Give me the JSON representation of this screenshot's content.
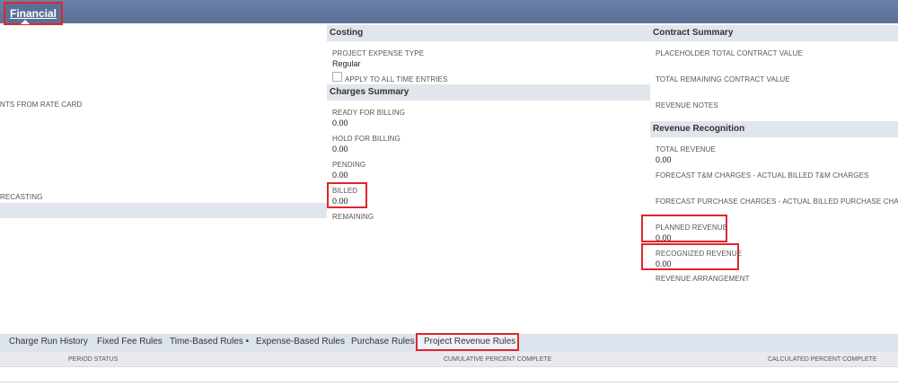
{
  "tabs": {
    "financial": "Financial"
  },
  "left": {
    "rate_card_label": "NTS FROM RATE CARD",
    "forecasting_label": "RECASTING"
  },
  "costing": {
    "header": "Costing",
    "expense_type_label": "PROJECT EXPENSE TYPE",
    "expense_type_value": "Regular",
    "apply_label": "APPLY TO ALL TIME ENTRIES"
  },
  "charges_summary": {
    "header": "Charges Summary",
    "ready_label": "READY FOR BILLING",
    "ready_value": "0.00",
    "hold_label": "HOLD FOR BILLING",
    "hold_value": "0.00",
    "pending_label": "PENDING",
    "pending_value": "0.00",
    "billed_label": "BILLED",
    "billed_value": "0.00",
    "remaining_label": "REMAINING"
  },
  "contract_summary": {
    "header": "Contract Summary",
    "placeholder_label": "PLACEHOLDER TOTAL CONTRACT VALUE",
    "remaining_label": "TOTAL REMAINING CONTRACT VALUE",
    "revenue_notes_label": "REVENUE NOTES"
  },
  "revenue_recognition": {
    "header": "Revenue Recognition",
    "total_label": "TOTAL REVENUE",
    "total_value": "0.00",
    "forecast_tm_label": "FORECAST T&M CHARGES - ACTUAL BILLED T&M CHARGES",
    "forecast_purchase_label": "FORECAST PURCHASE CHARGES - ACTUAL BILLED PURCHASE CHARGES",
    "planned_label": "PLANNED REVENUE",
    "planned_value": "0.00",
    "recognized_label": "RECOGNIZED REVENUE",
    "recognized_value": "0.00",
    "arrangement_label": "REVENUE ARRANGEMENT"
  },
  "subtabs": {
    "charge_run_history": "Charge Run History",
    "fixed_fee_rules": "Fixed Fee Rules",
    "time_based_rules": "Time-Based Rules •",
    "expense_based_rules": "Expense-Based Rules",
    "purchase_rules": "Purchase Rules",
    "project_revenue_rules": "Project Revenue Rules"
  },
  "table_columns": {
    "period_status": "PERIOD STATUS",
    "cumulative_percent": "CUMULATIVE PERCENT COMPLETE",
    "calculated_percent": "CALCULATED PERCENT COMPLETE"
  },
  "colors": {
    "topbar": "#5a6f95",
    "highlight": "#e0252b",
    "section_bg": "#e1e5ec"
  }
}
